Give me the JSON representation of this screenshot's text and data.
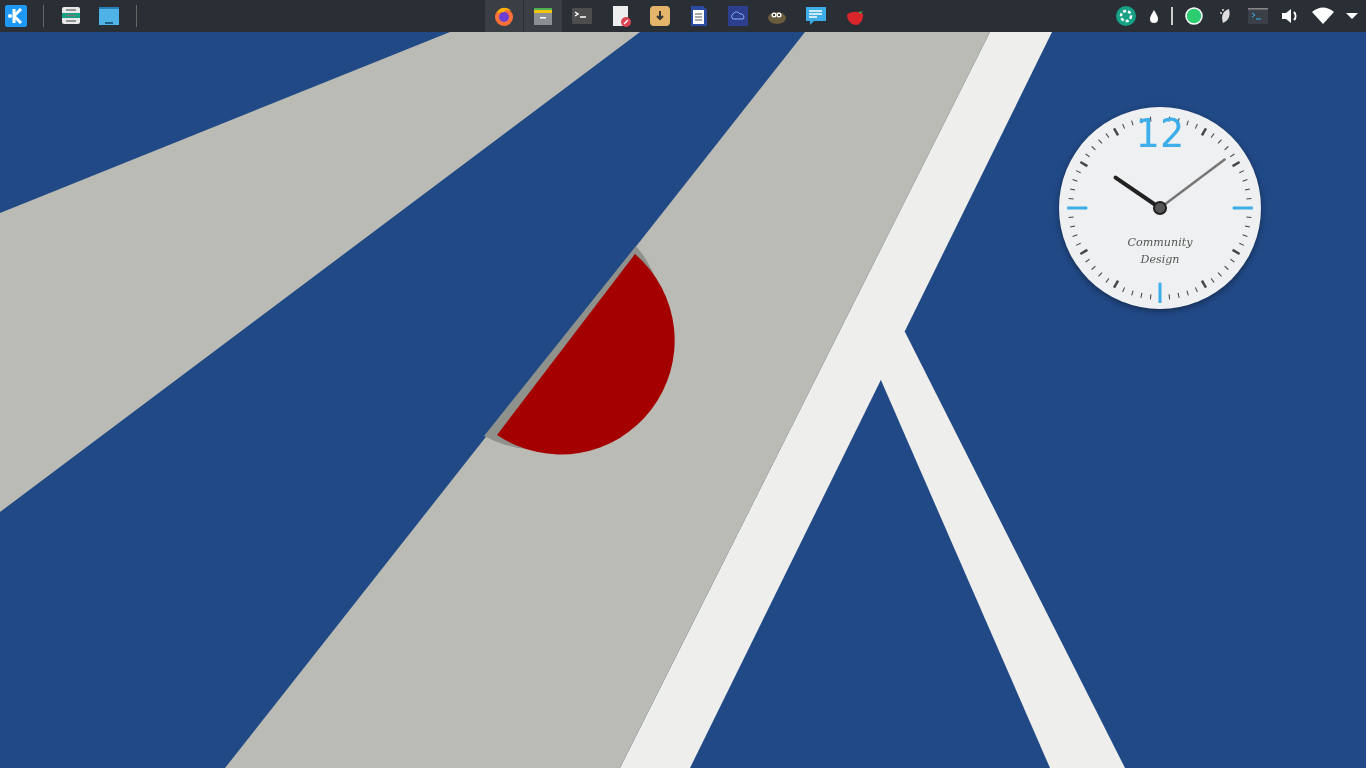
{
  "panel": {
    "tasks": [
      {
        "kind": "browser",
        "selected": true
      },
      {
        "kind": "files",
        "selected": true
      },
      {
        "kind": "terminal",
        "selected": false
      },
      {
        "kind": "editor",
        "selected": false
      },
      {
        "kind": "download",
        "selected": false
      },
      {
        "kind": "document",
        "selected": false
      },
      {
        "kind": "cloud",
        "selected": false
      },
      {
        "kind": "gimp",
        "selected": false
      },
      {
        "kind": "chat",
        "selected": false
      },
      {
        "kind": "strawberry",
        "selected": false
      }
    ]
  },
  "clock": {
    "numeral": "12",
    "caption": [
      "Community",
      "Design"
    ]
  }
}
